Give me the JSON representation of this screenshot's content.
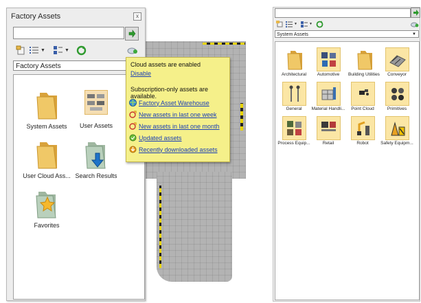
{
  "left_palette": {
    "title": "Factory Assets",
    "close_glyph": "x",
    "search_value": "",
    "category": "Factory Assets",
    "items": [
      {
        "label": "System Assets",
        "icon": "folder-icon"
      },
      {
        "label": "User Assets",
        "icon": "user-assets-icon"
      },
      {
        "label": "User Cloud Ass...",
        "icon": "folder-icon"
      },
      {
        "label": "Search Results",
        "icon": "search-results-icon"
      },
      {
        "label": "Favorites",
        "icon": "favorites-icon"
      }
    ]
  },
  "cloud_popup": {
    "status": "Cloud assets are enabled",
    "disable_link": "Disable",
    "subscription_note": "Subscription-only assets are available.",
    "links": [
      "Factory Asset Warehouse",
      "New assets in last one week",
      "New assets in last one month",
      "Updated assets",
      "Recently downloaded assets"
    ]
  },
  "right_palette": {
    "search_value": "",
    "category": "System Assets",
    "items": [
      "Architectural",
      "Automotive",
      "Building Utilities",
      "Conveyor",
      "General",
      "Material Handli...",
      "Point Cloud",
      "Primitives",
      "Process Equip...",
      "Retail",
      "Robot",
      "Safety Equipm..."
    ]
  },
  "colors": {
    "popup_bg": "#f5f08a",
    "link": "#1a3fb5",
    "tile_bg": "#fbe6a5",
    "folder": "#e8b84a"
  }
}
